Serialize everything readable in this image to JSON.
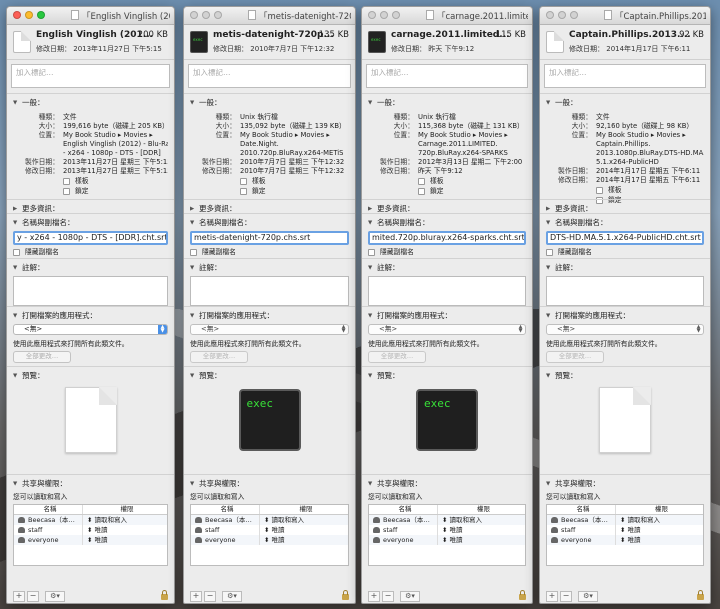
{
  "labels": {
    "tags_placeholder": "加入標記…",
    "general": "一般：",
    "kind": "種類：",
    "size": "大小：",
    "where": "位置：",
    "created": "製作日期：",
    "modified": "修改日期：",
    "modified_header": "修改日期：",
    "stationery": "樣板",
    "locked": "鎖定",
    "more_info": "更多資訊：",
    "name_ext": "名稱與副檔名：",
    "hide_ext": "隱藏副檔名",
    "comments": "註解：",
    "open_with": "打開檔案的應用程式：",
    "use_for_all": "使用此應用程式來打開所有此類文件。",
    "change_all": "全部更改…",
    "preview": "預覽：",
    "sharing": "共享與權限：",
    "can_read_write": "您可以讀取和寫入",
    "col_name": "名稱",
    "col_priv": "權限",
    "plus": "+",
    "minus": "−",
    "gear": "⚙▾"
  },
  "windows": [
    {
      "title": "「English Vinglish (2012)...",
      "name": "English Vinglish (201...",
      "size_short": "200 KB",
      "mod_header": "2013年11月27日 下午5:15",
      "kind": "文件",
      "size": "199,616 byte（磁碟上 205 KB）",
      "where": [
        "My Book Studio ▸ Movies ▸",
        "English Vinglish (2012) - Blu-Ray",
        "- x264 - 1080p - DTS - [DDR]"
      ],
      "created": "2013年11月27日 星期三 下午5:15",
      "modified": "2013年11月27日 星期三 下午5:15",
      "filename": "y - x264 - 1080p - DTS - [DDR].cht.srt",
      "open_with": "<無>",
      "preview": "doc",
      "users": [
        {
          "name": "Beecasa（本…",
          "priv": "讀取和寫入"
        },
        {
          "name": "staff",
          "priv": "唯讀"
        },
        {
          "name": "everyone",
          "priv": "唯讀"
        }
      ]
    },
    {
      "title": "「metis-datenight-720p...",
      "name": "metis-datenight-720p...",
      "size_short": "135 KB",
      "mod_header": "2010年7月7日 下午12:32",
      "kind": "Unix 執行檔",
      "size": "135,092 byte（磁碟上 139 KB）",
      "where": [
        "My Book Studio ▸ Movies ▸",
        "Date.Night.",
        "2010.720p.BluRay.x264-METiS"
      ],
      "created": "2010年7月7日 星期三 下午12:32",
      "modified": "2010年7月7日 星期三 下午12:32",
      "filename": "metis-datenight-720p.chs.srt",
      "open_with": "<無>",
      "preview": "exec",
      "preview_text": "exec",
      "users": [
        {
          "name": "Beecasa（本…",
          "priv": "讀取和寫入"
        },
        {
          "name": "staff",
          "priv": "唯讀"
        },
        {
          "name": "everyone",
          "priv": "唯讀"
        }
      ]
    },
    {
      "title": "「carnage.2011.limited.7...",
      "name": "carnage.2011.limited...",
      "size_short": "115 KB",
      "mod_header": "昨天 下午9:12",
      "kind": "Unix 執行檔",
      "size": "115,368 byte（磁碟上 131 KB）",
      "where": [
        "My Book Studio ▸ Movies ▸",
        "Carnage.2011.LIMITED.",
        "720p.BluRay.x264-SPARKS"
      ],
      "created": "2012年3月13日 星期二 下午2:00",
      "modified": "昨天 下午9:12",
      "filename": "mited.720p.bluray.x264-sparks.cht.srt",
      "open_with": "<無>",
      "preview": "exec",
      "preview_text": "exec",
      "users": [
        {
          "name": "Beecasa（本…",
          "priv": "讀取和寫入"
        },
        {
          "name": "staff",
          "priv": "唯讀"
        },
        {
          "name": "everyone",
          "priv": "唯讀"
        }
      ]
    },
    {
      "title": "「Captain.Phillips.2013.1...",
      "name": "Captain.Phillips.2013....",
      "size_short": "92 KB",
      "mod_header": "2014年1月17日 下午6:11",
      "kind": "文件",
      "size": "92,160 byte（磁碟上 98 KB）",
      "where": [
        "My Book Studio ▸ Movies ▸",
        "Captain.Phillips.",
        "2013.1080p.BluRay.DTS-HD.MA.",
        "5.1.x264-PublicHD"
      ],
      "created": "2014年1月17日 星期五 下午6:11",
      "modified": "2014年1月17日 星期五 下午6:11",
      "filename": "DTS-HD.MA.5.1.x264-PublicHD.cht.srt",
      "open_with": "<無>",
      "preview": "doc",
      "users": [
        {
          "name": "Beecasa（本…",
          "priv": "讀取和寫入"
        },
        {
          "name": "staff",
          "priv": "唯讀"
        },
        {
          "name": "everyone",
          "priv": "唯讀"
        }
      ]
    }
  ]
}
